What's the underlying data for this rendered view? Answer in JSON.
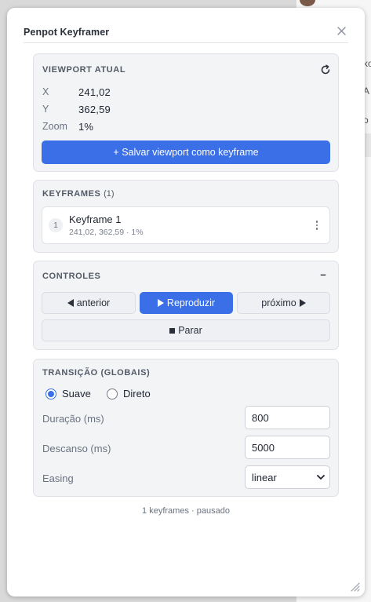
{
  "background": {
    "frag1": "ko",
    "frag2": "A",
    "frag3": "o"
  },
  "window": {
    "title": "Penpot Keyframer"
  },
  "viewport": {
    "heading": "VIEWPORT ATUAL",
    "x_label": "X",
    "x_value": "241,02",
    "y_label": "Y",
    "y_value": "362,59",
    "zoom_label": "Zoom",
    "zoom_value": "1%",
    "save_button": "+ Salvar viewport como keyframe"
  },
  "keyframes": {
    "heading": "KEYFRAMES",
    "count": "(1)",
    "items": [
      {
        "index": "1",
        "name": "Keyframe 1",
        "meta": "241,02, 362,59 · 1%"
      }
    ]
  },
  "controls": {
    "heading": "CONTROLES",
    "collapse_label": "–",
    "prev": "anterior",
    "play": "Reproduzir",
    "next": "próximo",
    "stop": "Parar"
  },
  "transition": {
    "heading": "TRANSIÇÃO (GLOBAIS)",
    "mode_smooth": "Suave",
    "mode_direct": "Direto",
    "selected_mode": "Suave",
    "duration_label": "Duração (ms)",
    "duration_value": "800",
    "rest_label": "Descanso (ms)",
    "rest_value": "5000",
    "easing_label": "Easing",
    "easing_value": "linear"
  },
  "status": "1 keyframes · pausado",
  "colors": {
    "accent": "#3a6fe8",
    "card_bg": "#f3f4f6"
  }
}
